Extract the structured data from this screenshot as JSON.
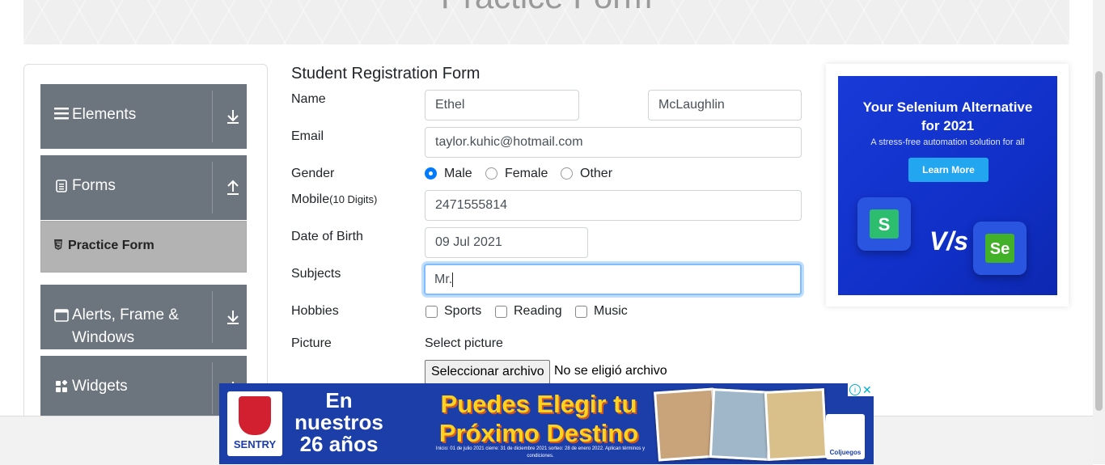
{
  "banner": {
    "title": "Practice Form"
  },
  "sidebar": {
    "groups": [
      {
        "label": "Elements",
        "icon": "hamburger-icon",
        "arrow": "download-arrow-icon"
      },
      {
        "label": "Forms",
        "icon": "document-icon",
        "arrow": "upload-arrow-icon"
      },
      {
        "label_line1": "Alerts, Frame &",
        "label_line2": "Windows",
        "icon": "window-icon",
        "arrow": "download-arrow-icon"
      },
      {
        "label": "Widgets",
        "icon": "widgets-icon",
        "arrow": "download-arrow-icon"
      }
    ],
    "active_item": {
      "label": "Practice Form",
      "icon": "html5-icon"
    }
  },
  "form": {
    "title": "Student Registration Form",
    "name": {
      "label": "Name",
      "first": "Ethel",
      "last": "McLaughlin"
    },
    "email": {
      "label": "Email",
      "value": "taylor.kuhic@hotmail.com"
    },
    "gender": {
      "label": "Gender",
      "options": [
        "Male",
        "Female",
        "Other"
      ],
      "selected": "Male"
    },
    "mobile": {
      "label": "Mobile",
      "hint": "(10 Digits)",
      "value": "2471555814"
    },
    "dob": {
      "label": "Date of Birth",
      "value": "09 Jul 2021"
    },
    "subjects": {
      "label": "Subjects",
      "value": "Mr."
    },
    "hobbies": {
      "label": "Hobbies",
      "options": [
        "Sports",
        "Reading",
        "Music"
      ]
    },
    "picture": {
      "label": "Picture",
      "select_label": "Select picture",
      "button": "Seleccionar archivo",
      "status": "No se eligió archivo"
    }
  },
  "side_ad": {
    "headline_line1": "Your Selenium Alternative",
    "headline_line2": "for 2021",
    "sub": "A stress-free automation solution for all",
    "cta": "Learn More",
    "vs": "V/s",
    "left_logo": "S",
    "right_logo": "Se"
  },
  "bottom_ad": {
    "brand": "SENTRY",
    "years_line1": "En",
    "years_line2": "nuestros",
    "years_line3": "26 años",
    "headline_line1": "Puedes Elegir tu",
    "headline_line2": "Próximo Destino",
    "fine_print": "Inicio: 01 de julio 2021 cierre: 31 de diciembre 2021 sorteo: 28 de enero 2022. Aplican términos y condiciones.",
    "partner": "Coljuegos",
    "adchoices": "i",
    "close": "✕"
  },
  "colors": {
    "sidebar_group": "#6c757d",
    "active_item": "#b3b3b3",
    "focus_border": "#80bdff",
    "radio_checked": "#007bff",
    "side_ad_bg": "#1a3ad8",
    "bottom_ad_bg": "#1c3ea8",
    "bottom_ad_headline": "#ffd21f"
  }
}
